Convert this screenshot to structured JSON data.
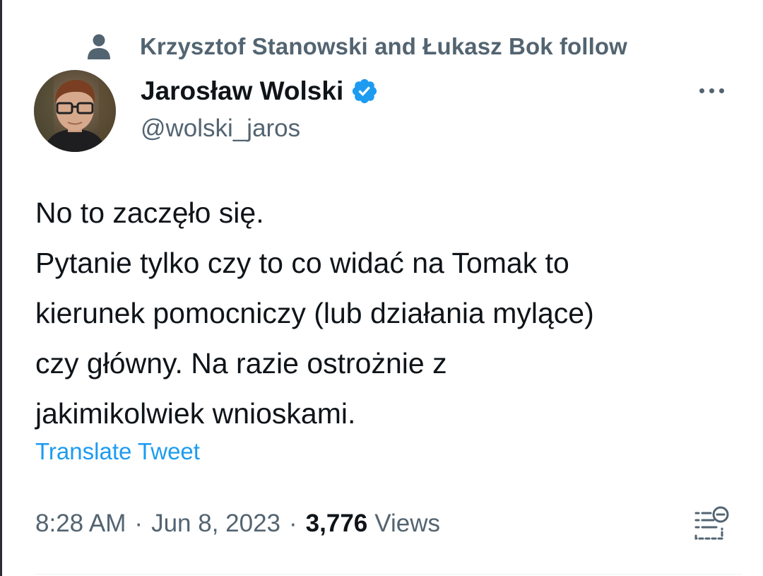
{
  "social_context": {
    "icon": "person-icon",
    "text": "Krzysztof Stanowski and Łukasz Bok follow"
  },
  "author": {
    "display_name": "Jarosław Wolski",
    "verified": true,
    "verified_color": "#1d9bf0",
    "handle": "@wolski_jaros"
  },
  "tweet": {
    "lines": [
      "No to zaczęło się.",
      "Pytanie tylko czy to co widać na Tomak to",
      "kierunek pomocniczy (lub działania mylące)",
      "czy główny. Na razie ostrożnie z",
      "jakimikolwiek wnioskami."
    ],
    "translate_label": "Translate Tweet"
  },
  "meta": {
    "time": "8:28 AM",
    "date": "Jun 8, 2023",
    "separator": "·",
    "views_count": "3,776",
    "views_label": "Views"
  },
  "colors": {
    "text_primary": "#0f1419",
    "text_secondary": "#536471",
    "link": "#1d9bf0"
  }
}
